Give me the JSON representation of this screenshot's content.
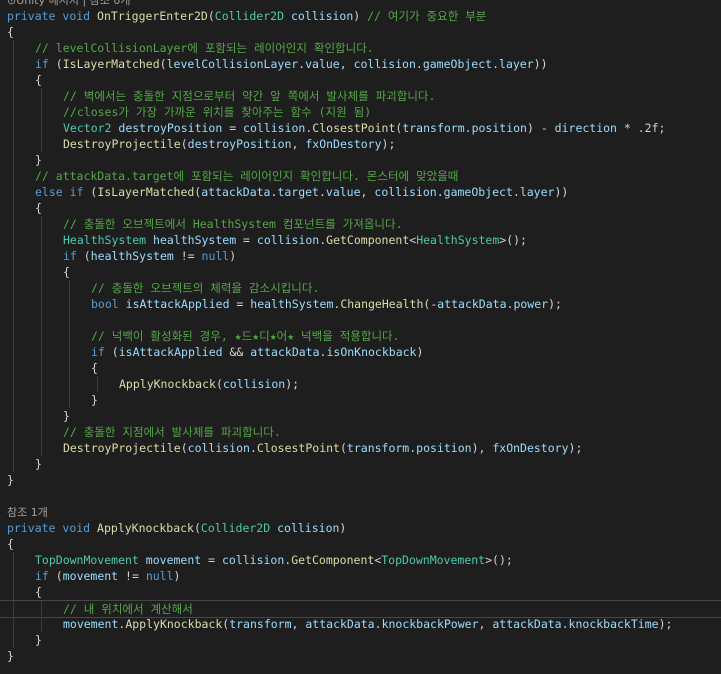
{
  "colors": {
    "background": "#1e1e1e",
    "keyword": "#569cd6",
    "type": "#4ec9b0",
    "method": "#dcdcaa",
    "identifier": "#9cdcfe",
    "comment": "#57a64a",
    "control": "#d8a0df",
    "plain": "#d4d4d4",
    "codelens": "#a0a0a0"
  },
  "editor": {
    "lines": [
      {
        "indent": 0,
        "tokens": [
          {
            "t": "lens",
            "v": "⊙Unity 메시지 | 참조 0개"
          }
        ]
      },
      {
        "indent": 0,
        "tokens": [
          {
            "t": "kw",
            "v": "private"
          },
          {
            "t": "pl",
            "v": " "
          },
          {
            "t": "kw",
            "v": "void"
          },
          {
            "t": "pl",
            "v": " "
          },
          {
            "t": "fn",
            "v": "OnTriggerEnter2D"
          },
          {
            "t": "pl",
            "v": "("
          },
          {
            "t": "ty",
            "v": "Collider2D"
          },
          {
            "t": "pl",
            "v": " "
          },
          {
            "t": "id",
            "v": "collision"
          },
          {
            "t": "pl",
            "v": ") "
          },
          {
            "t": "cm",
            "v": "// 여기가 중요한 부분"
          }
        ]
      },
      {
        "indent": 0,
        "tokens": [
          {
            "t": "pl",
            "v": "{"
          }
        ]
      },
      {
        "indent": 1,
        "tokens": [
          {
            "t": "cm",
            "v": "// levelCollisionLayer에 포함되는 레이어인지 확인합니다."
          }
        ]
      },
      {
        "indent": 1,
        "tokens": [
          {
            "t": "kw",
            "v": "if"
          },
          {
            "t": "pl",
            "v": " ("
          },
          {
            "t": "fn",
            "v": "IsLayerMatched"
          },
          {
            "t": "pl",
            "v": "("
          },
          {
            "t": "id",
            "v": "levelCollisionLayer"
          },
          {
            "t": "pl",
            "v": "."
          },
          {
            "t": "id",
            "v": "value"
          },
          {
            "t": "pl",
            "v": ", "
          },
          {
            "t": "id",
            "v": "collision"
          },
          {
            "t": "pl",
            "v": "."
          },
          {
            "t": "id",
            "v": "gameObject"
          },
          {
            "t": "pl",
            "v": "."
          },
          {
            "t": "id",
            "v": "layer"
          },
          {
            "t": "pl",
            "v": "))"
          }
        ]
      },
      {
        "indent": 1,
        "tokens": [
          {
            "t": "pl",
            "v": "{"
          }
        ]
      },
      {
        "indent": 2,
        "tokens": [
          {
            "t": "cm",
            "v": "// 벽에서는 충돌한 지점으로부터 약간 앞 쪽에서 발사체를 파괴합니다."
          }
        ]
      },
      {
        "indent": 2,
        "tokens": [
          {
            "t": "cm",
            "v": "//closes가 가장 가까운 위치를 찾아주는 함수 (지원 됨)"
          }
        ]
      },
      {
        "indent": 2,
        "tokens": [
          {
            "t": "ty",
            "v": "Vector2"
          },
          {
            "t": "pl",
            "v": " "
          },
          {
            "t": "id",
            "v": "destroyPosition"
          },
          {
            "t": "pl",
            "v": " = "
          },
          {
            "t": "id",
            "v": "collision"
          },
          {
            "t": "pl",
            "v": "."
          },
          {
            "t": "fn",
            "v": "ClosestPoint"
          },
          {
            "t": "pl",
            "v": "("
          },
          {
            "t": "id",
            "v": "transform"
          },
          {
            "t": "pl",
            "v": "."
          },
          {
            "t": "id",
            "v": "position"
          },
          {
            "t": "pl",
            "v": ") - "
          },
          {
            "t": "id",
            "v": "direction"
          },
          {
            "t": "pl",
            "v": " * .2f;"
          }
        ]
      },
      {
        "indent": 2,
        "tokens": [
          {
            "t": "fn",
            "v": "DestroyProjectile"
          },
          {
            "t": "pl",
            "v": "("
          },
          {
            "t": "id",
            "v": "destroyPosition"
          },
          {
            "t": "pl",
            "v": ", "
          },
          {
            "t": "id",
            "v": "fxOnDestory"
          },
          {
            "t": "pl",
            "v": ");"
          }
        ]
      },
      {
        "indent": 1,
        "tokens": [
          {
            "t": "pl",
            "v": "}"
          }
        ]
      },
      {
        "indent": 1,
        "tokens": [
          {
            "t": "cm",
            "v": "// attackData.target에 포함되는 레이어인지 확인합니다. 몬스터에 맞았을때"
          }
        ]
      },
      {
        "indent": 1,
        "tokens": [
          {
            "t": "kw",
            "v": "else"
          },
          {
            "t": "pl",
            "v": " "
          },
          {
            "t": "kw",
            "v": "if"
          },
          {
            "t": "pl",
            "v": " ("
          },
          {
            "t": "fn",
            "v": "IsLayerMatched"
          },
          {
            "t": "pl",
            "v": "("
          },
          {
            "t": "id",
            "v": "attackData"
          },
          {
            "t": "pl",
            "v": "."
          },
          {
            "t": "id",
            "v": "target"
          },
          {
            "t": "pl",
            "v": "."
          },
          {
            "t": "id",
            "v": "value"
          },
          {
            "t": "pl",
            "v": ", "
          },
          {
            "t": "id",
            "v": "collision"
          },
          {
            "t": "pl",
            "v": "."
          },
          {
            "t": "id",
            "v": "gameObject"
          },
          {
            "t": "pl",
            "v": "."
          },
          {
            "t": "id",
            "v": "layer"
          },
          {
            "t": "pl",
            "v": "))"
          }
        ]
      },
      {
        "indent": 1,
        "tokens": [
          {
            "t": "pl",
            "v": "{"
          }
        ]
      },
      {
        "indent": 2,
        "tokens": [
          {
            "t": "cm",
            "v": "// 충돌한 오브젝트에서 HealthSystem 컴포넌트를 가져옵니다."
          }
        ]
      },
      {
        "indent": 2,
        "tokens": [
          {
            "t": "ty",
            "v": "HealthSystem"
          },
          {
            "t": "pl",
            "v": " "
          },
          {
            "t": "id",
            "v": "healthSystem"
          },
          {
            "t": "pl",
            "v": " = "
          },
          {
            "t": "id",
            "v": "collision"
          },
          {
            "t": "pl",
            "v": "."
          },
          {
            "t": "fn",
            "v": "GetComponent"
          },
          {
            "t": "pl",
            "v": "<"
          },
          {
            "t": "ty",
            "v": "HealthSystem"
          },
          {
            "t": "pl",
            "v": ">();"
          }
        ]
      },
      {
        "indent": 2,
        "tokens": [
          {
            "t": "kw",
            "v": "if"
          },
          {
            "t": "pl",
            "v": " ("
          },
          {
            "t": "id",
            "v": "healthSystem"
          },
          {
            "t": "pl",
            "v": " != "
          },
          {
            "t": "kw",
            "v": "null"
          },
          {
            "t": "pl",
            "v": ")"
          }
        ]
      },
      {
        "indent": 2,
        "tokens": [
          {
            "t": "pl",
            "v": "{"
          }
        ]
      },
      {
        "indent": 3,
        "tokens": [
          {
            "t": "cm",
            "v": "// 충돌한 오브젝트의 체력을 감소시킵니다."
          }
        ]
      },
      {
        "indent": 3,
        "tokens": [
          {
            "t": "kw",
            "v": "bool"
          },
          {
            "t": "pl",
            "v": " "
          },
          {
            "t": "id",
            "v": "isAttackApplied"
          },
          {
            "t": "pl",
            "v": " = "
          },
          {
            "t": "id",
            "v": "healthSystem"
          },
          {
            "t": "pl",
            "v": "."
          },
          {
            "t": "fn",
            "v": "ChangeHealth"
          },
          {
            "t": "pl",
            "v": "(-"
          },
          {
            "t": "id",
            "v": "attackData"
          },
          {
            "t": "pl",
            "v": "."
          },
          {
            "t": "id",
            "v": "power"
          },
          {
            "t": "pl",
            "v": ");"
          }
        ]
      },
      {
        "indent": 3,
        "tokens": []
      },
      {
        "indent": 3,
        "tokens": [
          {
            "t": "cm",
            "v": "// 넉백이 활성화된 경우, ★드★디★어★ 넉백을 적용합니다."
          }
        ]
      },
      {
        "indent": 3,
        "tokens": [
          {
            "t": "kw",
            "v": "if"
          },
          {
            "t": "pl",
            "v": " ("
          },
          {
            "t": "id",
            "v": "isAttackApplied"
          },
          {
            "t": "pl",
            "v": " && "
          },
          {
            "t": "id",
            "v": "attackData"
          },
          {
            "t": "pl",
            "v": "."
          },
          {
            "t": "id",
            "v": "isOnKnockback"
          },
          {
            "t": "pl",
            "v": ")"
          }
        ]
      },
      {
        "indent": 3,
        "tokens": [
          {
            "t": "pl",
            "v": "{"
          }
        ]
      },
      {
        "indent": 4,
        "tokens": [
          {
            "t": "fn",
            "v": "ApplyKnockback"
          },
          {
            "t": "pl",
            "v": "("
          },
          {
            "t": "id",
            "v": "collision"
          },
          {
            "t": "pl",
            "v": ");"
          }
        ]
      },
      {
        "indent": 3,
        "tokens": [
          {
            "t": "pl",
            "v": "}"
          }
        ]
      },
      {
        "indent": 2,
        "tokens": [
          {
            "t": "pl",
            "v": "}"
          }
        ]
      },
      {
        "indent": 2,
        "tokens": [
          {
            "t": "cm",
            "v": "// 충돌한 지점에서 발사체를 파괴합니다."
          }
        ]
      },
      {
        "indent": 2,
        "tokens": [
          {
            "t": "fn",
            "v": "DestroyProjectile"
          },
          {
            "t": "pl",
            "v": "("
          },
          {
            "t": "id",
            "v": "collision"
          },
          {
            "t": "pl",
            "v": "."
          },
          {
            "t": "fn",
            "v": "ClosestPoint"
          },
          {
            "t": "pl",
            "v": "("
          },
          {
            "t": "id",
            "v": "transform"
          },
          {
            "t": "pl",
            "v": "."
          },
          {
            "t": "id",
            "v": "position"
          },
          {
            "t": "pl",
            "v": "), "
          },
          {
            "t": "id",
            "v": "fxOnDestory"
          },
          {
            "t": "pl",
            "v": ");"
          }
        ]
      },
      {
        "indent": 1,
        "tokens": [
          {
            "t": "pl",
            "v": "}"
          }
        ]
      },
      {
        "indent": 0,
        "tokens": [
          {
            "t": "pl",
            "v": "}"
          }
        ]
      },
      {
        "indent": 0,
        "tokens": []
      },
      {
        "indent": 0,
        "tokens": [
          {
            "t": "lens",
            "v": "참조 1개"
          }
        ]
      },
      {
        "indent": 0,
        "tokens": [
          {
            "t": "kw",
            "v": "private"
          },
          {
            "t": "pl",
            "v": " "
          },
          {
            "t": "kw",
            "v": "void"
          },
          {
            "t": "pl",
            "v": " "
          },
          {
            "t": "fn",
            "v": "ApplyKnockback"
          },
          {
            "t": "pl",
            "v": "("
          },
          {
            "t": "ty",
            "v": "Collider2D"
          },
          {
            "t": "pl",
            "v": " "
          },
          {
            "t": "id",
            "v": "collision"
          },
          {
            "t": "pl",
            "v": ")"
          }
        ]
      },
      {
        "indent": 0,
        "tokens": [
          {
            "t": "pl",
            "v": "{"
          }
        ]
      },
      {
        "indent": 1,
        "tokens": [
          {
            "t": "ty",
            "v": "TopDownMovement"
          },
          {
            "t": "pl",
            "v": " "
          },
          {
            "t": "id",
            "v": "movement"
          },
          {
            "t": "pl",
            "v": " = "
          },
          {
            "t": "id",
            "v": "collision"
          },
          {
            "t": "pl",
            "v": "."
          },
          {
            "t": "fn",
            "v": "GetComponent"
          },
          {
            "t": "pl",
            "v": "<"
          },
          {
            "t": "ty",
            "v": "TopDownMovement"
          },
          {
            "t": "pl",
            "v": ">();"
          }
        ]
      },
      {
        "indent": 1,
        "tokens": [
          {
            "t": "kw",
            "v": "if"
          },
          {
            "t": "pl",
            "v": " ("
          },
          {
            "t": "id",
            "v": "movement"
          },
          {
            "t": "pl",
            "v": " != "
          },
          {
            "t": "kw",
            "v": "null"
          },
          {
            "t": "pl",
            "v": ")"
          }
        ]
      },
      {
        "indent": 1,
        "tokens": [
          {
            "t": "pl",
            "v": "{"
          }
        ]
      },
      {
        "indent": 2,
        "tokens": [
          {
            "t": "cm",
            "v": "// 내 위치에서 계산해서"
          }
        ],
        "current": true
      },
      {
        "indent": 2,
        "tokens": [
          {
            "t": "id",
            "v": "movement"
          },
          {
            "t": "pl",
            "v": "."
          },
          {
            "t": "fn",
            "v": "ApplyKnockback"
          },
          {
            "t": "pl",
            "v": "("
          },
          {
            "t": "id",
            "v": "transform"
          },
          {
            "t": "pl",
            "v": ", "
          },
          {
            "t": "id",
            "v": "attackData"
          },
          {
            "t": "pl",
            "v": "."
          },
          {
            "t": "id",
            "v": "knockbackPower"
          },
          {
            "t": "pl",
            "v": ", "
          },
          {
            "t": "id",
            "v": "attackData"
          },
          {
            "t": "pl",
            "v": "."
          },
          {
            "t": "id",
            "v": "knockbackTime"
          },
          {
            "t": "pl",
            "v": ");"
          }
        ]
      },
      {
        "indent": 1,
        "tokens": [
          {
            "t": "pl",
            "v": "}"
          }
        ]
      },
      {
        "indent": 0,
        "tokens": [
          {
            "t": "pl",
            "v": "}"
          }
        ]
      }
    ]
  }
}
